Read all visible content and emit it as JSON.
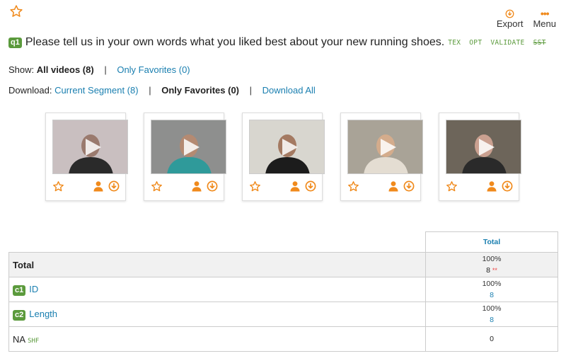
{
  "header": {
    "export_label": "Export",
    "menu_label": "Menu"
  },
  "question": {
    "badge": "q1",
    "text": "Please tell us in your own words what you liked best about your new running shoes.",
    "tags": [
      "TEX",
      "OPT",
      "VALIDATE",
      "SST"
    ]
  },
  "show": {
    "prefix": "Show:",
    "all_videos": "All videos (8)",
    "divider": "|",
    "only_favorites": "Only Favorites (0)"
  },
  "download": {
    "prefix": "Download:",
    "current_segment": "Current Segment (8)",
    "divider": "|",
    "only_favorites": "Only Favorites (0)",
    "download_all": "Download All"
  },
  "videos": [
    {
      "bg": "#c9bfc0",
      "skin": "#9a7a6e",
      "shirt": "#2a2a2a"
    },
    {
      "bg": "#8e8f8e",
      "skin": "#b48a72",
      "shirt": "#2f9a9a"
    },
    {
      "bg": "#d8d6cf",
      "skin": "#a47a62",
      "shirt": "#1c1c1c"
    },
    {
      "bg": "#a9a397",
      "skin": "#d4ac8c",
      "shirt": "#e4ddd2"
    },
    {
      "bg": "#6d655a",
      "skin": "#caa090",
      "shirt": "#2a2a2a"
    }
  ],
  "table": {
    "column_header": "Total",
    "rows": [
      {
        "label": "Total",
        "pct": "100%",
        "count": "8",
        "flag": "**"
      },
      {
        "badge": "c1",
        "label": "ID",
        "pct": "100%",
        "count": "8"
      },
      {
        "badge": "c2",
        "label": "Length",
        "pct": "100%",
        "count": "8"
      },
      {
        "label": "NA",
        "tag": "SHF",
        "pct": "",
        "count": "0"
      }
    ]
  },
  "colors": {
    "accent": "#f08a1c",
    "link": "#1a7fb0",
    "badge": "#5b9a3c"
  }
}
